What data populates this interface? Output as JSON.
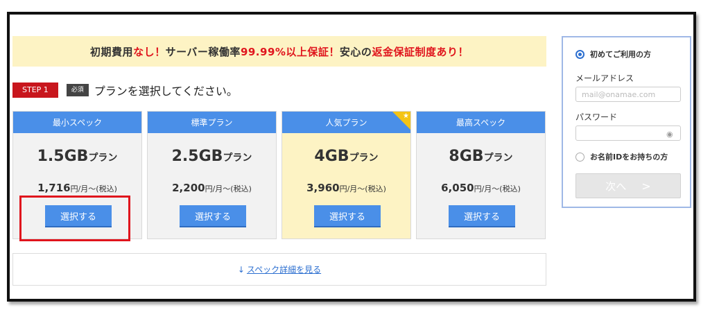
{
  "banner": {
    "part1": "初期費用",
    "part2": "なし！",
    "part3": "サーバー稼働率 ",
    "part4": "99.99%以上保証！",
    "part5": "安心の",
    "part6": "返金保証制度あり！"
  },
  "step": {
    "badge": "STEP 1",
    "required": "必須",
    "title": "プランを選択してください。"
  },
  "plans": [
    {
      "header": "最小スペック",
      "plan": "1.5GB",
      "suffix": "プラン",
      "price": "1,716",
      "unit": "円/月～(税込)",
      "button": "選択する"
    },
    {
      "header": "標準プラン",
      "plan": "2.5GB",
      "suffix": "プラン",
      "price": "2,200",
      "unit": "円/月～(税込)",
      "button": "選択する"
    },
    {
      "header": "人気プラン",
      "plan": "4GB",
      "suffix": "プラン",
      "price": "3,960",
      "unit": "円/月～(税込)",
      "button": "選択する"
    },
    {
      "header": "最高スペック",
      "plan": "8GB",
      "suffix": "プラン",
      "price": "6,050",
      "unit": "円/月～(税込)",
      "button": "選択する"
    }
  ],
  "detail": {
    "arrow": "↓",
    "link": "スペック詳細を見る"
  },
  "login": {
    "first_time": "初めてご利用の方",
    "email_label": "メールアドレス",
    "email_placeholder": "mail@onamae.com",
    "password_label": "パスワード",
    "has_id": "お名前IDをお持ちの方",
    "next": "次へ",
    "next_chevron": ">"
  },
  "colors": {
    "accent_blue": "#4a8fe8",
    "banner_bg": "#fdf3c4",
    "step_red": "#c8161d",
    "highlight_red": "#e0151d"
  },
  "icons": {
    "star": "★",
    "eye": "◉"
  }
}
